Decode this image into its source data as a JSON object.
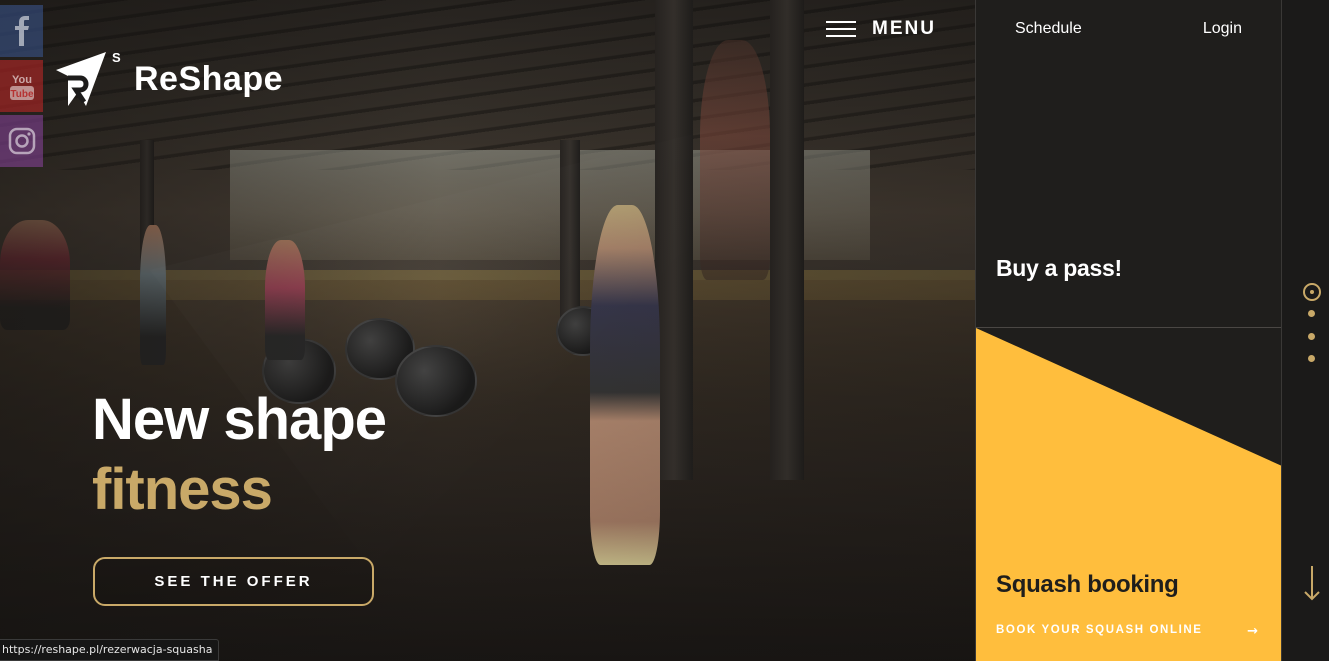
{
  "brand": {
    "name": "ReShape",
    "accent": "#c9a968",
    "yellow": "#ffbe3d"
  },
  "social": [
    {
      "icon": "facebook-icon",
      "label": "f"
    },
    {
      "icon": "youtube-icon",
      "label": "YouTube"
    },
    {
      "icon": "instagram-icon",
      "label": "Instagram"
    }
  ],
  "nav": {
    "menu_label": "MENU",
    "schedule": "Schedule",
    "login": "Login"
  },
  "hero": {
    "line1": "New shape",
    "line2": "fitness",
    "cta": "SEE THE OFFER"
  },
  "panel": {
    "buy_pass": "Buy a pass!",
    "squash_title": "Squash booking",
    "squash_link": "BOOK YOUR SQUASH ONLINE",
    "squash_arrow": "→"
  },
  "slider": {
    "dots": 4,
    "active_index": 0
  },
  "status_url": "https://reshape.pl/rezerwacja-squasha"
}
